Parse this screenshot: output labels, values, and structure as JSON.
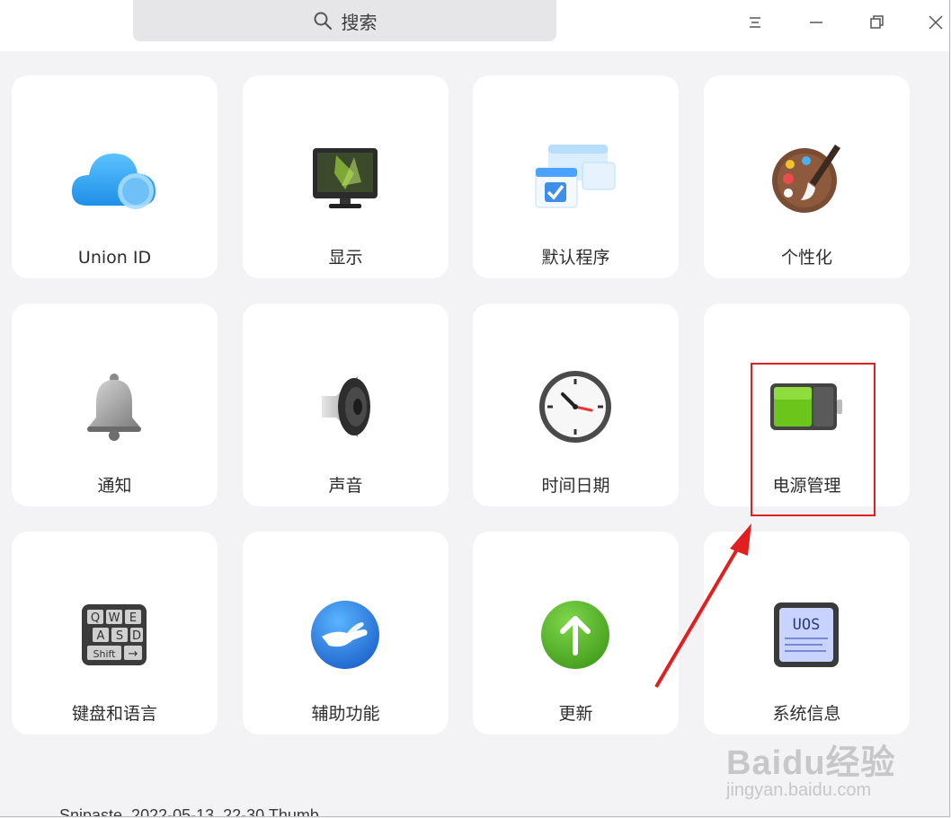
{
  "search": {
    "label": "搜索",
    "icon": "search-icon"
  },
  "window_controls": [
    "menu-icon",
    "minimize-icon",
    "restore-icon",
    "close-icon"
  ],
  "modules": [
    {
      "label": "Union ID",
      "icon": "cloud-icon"
    },
    {
      "label": "显示",
      "icon": "monitor-icon"
    },
    {
      "label": "默认程序",
      "icon": "default-apps-icon"
    },
    {
      "label": "个性化",
      "icon": "palette-icon"
    },
    {
      "label": "通知",
      "icon": "bell-icon"
    },
    {
      "label": "声音",
      "icon": "speaker-icon"
    },
    {
      "label": "时间日期",
      "icon": "clock-icon"
    },
    {
      "label": "电源管理",
      "icon": "battery-icon"
    },
    {
      "label": "键盘和语言",
      "icon": "keyboard-icon"
    },
    {
      "label": "辅助功能",
      "icon": "hand-icon"
    },
    {
      "label": "更新",
      "icon": "update-arrow-icon"
    },
    {
      "label": "系统信息",
      "icon": "system-info-icon"
    }
  ],
  "watermark": {
    "brand": "Baidu经验",
    "url": "jingyan.baidu.com"
  },
  "bottom_text": "Snipaste_2022-05-13_22-30 Thumb",
  "colors": {
    "highlight": "#e02020",
    "card_bg": "#ffffff",
    "window_bg": "#f3f3f5"
  }
}
